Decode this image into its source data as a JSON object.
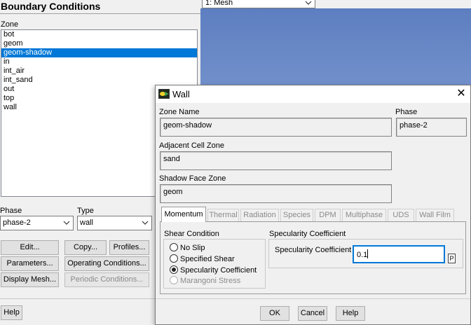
{
  "boundary_conditions": {
    "title": "Boundary Conditions",
    "zone_label": "Zone",
    "zones": [
      "bot",
      "geom",
      "geom-shadow",
      "in",
      "int_air",
      "int_sand",
      "out",
      "top",
      "wall"
    ],
    "selected_zone": "geom-shadow",
    "phase_label": "Phase",
    "phase_value": "phase-2",
    "type_label": "Type",
    "type_value": "wall",
    "buttons": {
      "edit": "Edit...",
      "copy": "Copy...",
      "profiles": "Profiles...",
      "parameters": "Parameters...",
      "operating_conditions": "Operating Conditions...",
      "display_mesh": "Display Mesh...",
      "periodic_conditions": "Periodic Conditions...",
      "help": "Help"
    }
  },
  "graphics": {
    "view_select": "1: Mesh",
    "background_top": "#5d7ec0",
    "background_bottom": "#a9bee4"
  },
  "wall_dialog": {
    "title": "Wall",
    "zone_name_label": "Zone Name",
    "zone_name_value": "geom-shadow",
    "phase_label": "Phase",
    "phase_value": "phase-2",
    "adjacent_cell_zone_label": "Adjacent Cell Zone",
    "adjacent_cell_zone_value": "sand",
    "shadow_face_zone_label": "Shadow Face Zone",
    "shadow_face_zone_value": "geom",
    "tabs": [
      "Momentum",
      "Thermal",
      "Radiation",
      "Species",
      "DPM",
      "Multiphase",
      "UDS",
      "Wall Film"
    ],
    "active_tab": "Momentum",
    "shear_condition": {
      "label": "Shear Condition",
      "options": [
        "No Slip",
        "Specified Shear",
        "Specularity Coefficient",
        "Marangoni Stress"
      ],
      "selected": "Specularity Coefficient",
      "disabled": [
        "Marangoni Stress"
      ]
    },
    "specularity": {
      "group_label": "Specularity Coefficient",
      "field_label": "Specularity Coefficient",
      "value": "0.1",
      "param_button": "P"
    },
    "buttons": {
      "ok": "OK",
      "cancel": "Cancel",
      "help": "Help"
    },
    "accent_color": "#0078d7"
  }
}
